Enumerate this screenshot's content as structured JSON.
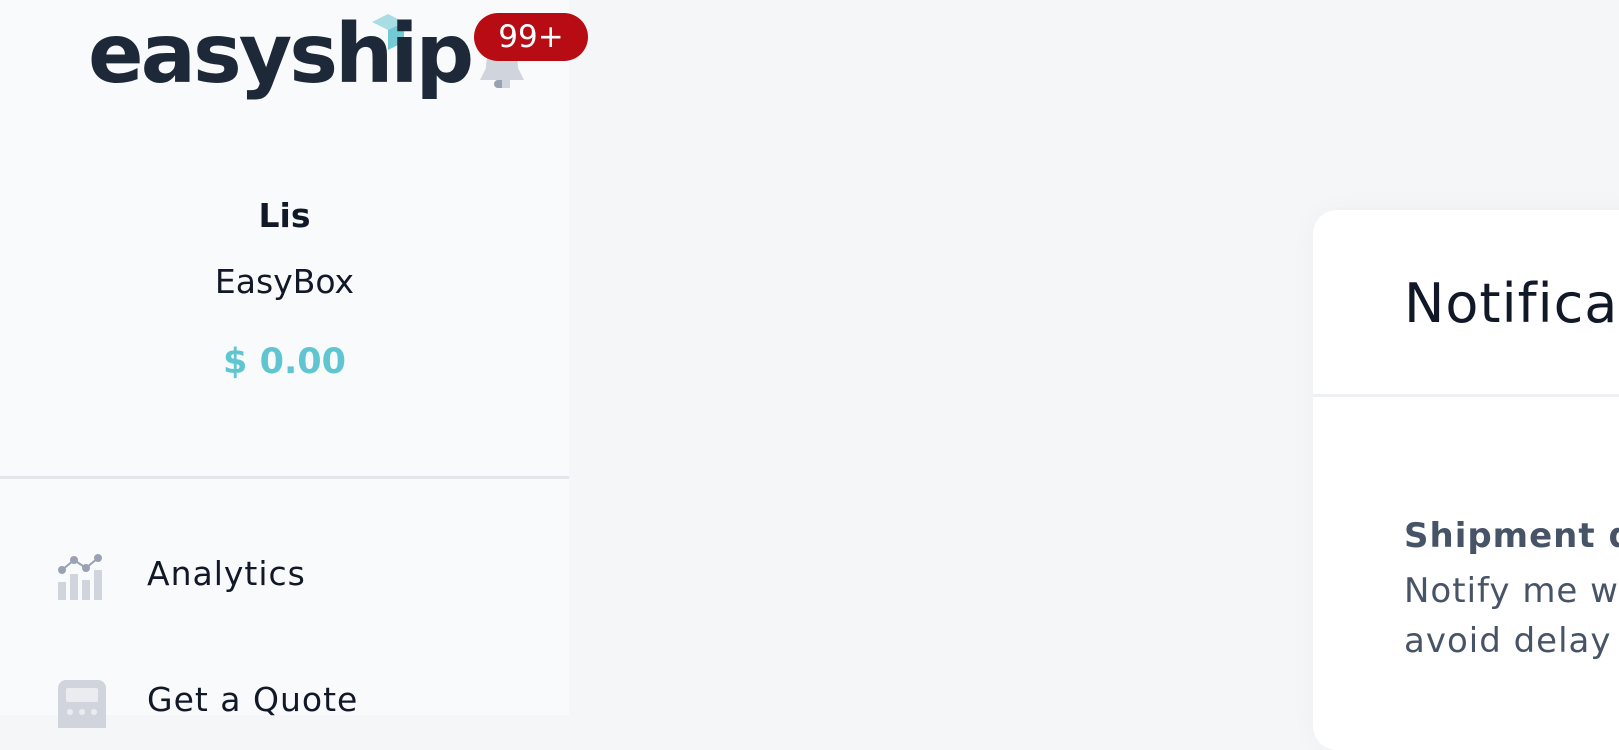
{
  "header": {
    "logo_text": "easyship",
    "notification_count": "99+"
  },
  "colors": {
    "brand_dark": "#1d2939",
    "brand_teal": "#5fc6d1",
    "badge_red": "#b80c14"
  },
  "user": {
    "name": "Lis",
    "company": "EasyBox",
    "balance": "$ 0.00"
  },
  "sidebar": {
    "items": [
      {
        "label": "Analytics",
        "icon": "analytics-icon"
      },
      {
        "label": "Get a Quote",
        "icon": "calculator-icon"
      }
    ]
  },
  "main": {
    "card_title": "Notifica",
    "setting_title": "Shipment d",
    "setting_description": "Notify me wl\navoid delay c"
  }
}
